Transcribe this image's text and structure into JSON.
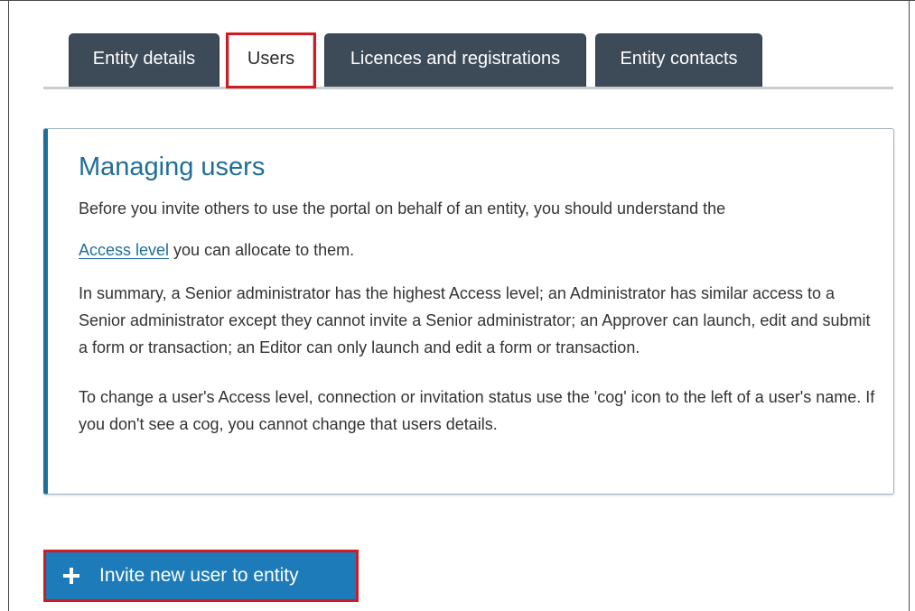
{
  "tabs": [
    {
      "label": "Entity details",
      "active": false
    },
    {
      "label": "Users",
      "active": true
    },
    {
      "label": "Licences and registrations",
      "active": false
    },
    {
      "label": "Entity contacts",
      "active": false
    }
  ],
  "info": {
    "title": "Managing users",
    "p1": "Before you invite others to use the portal on behalf of an entity, you should understand the",
    "p2_link": "Access level",
    "p2_rest": " you can allocate to them.",
    "p3": "In summary, a Senior administrator has the highest Access level; an Administrator has similar access to a Senior administrator except they cannot invite a Senior administrator; an Approver can launch, edit and submit a form or transaction; an Editor can only launch and edit a form or transaction.",
    "p4": "To change a user's Access level, connection or invitation status use the 'cog' icon to the left of a user's name. If you don't see a cog, you cannot change that users details."
  },
  "invite_button": {
    "label": "Invite new user to entity",
    "icon": "plus-icon"
  },
  "colors": {
    "tab_dark": "#3d4a58",
    "accent_blue": "#1f6e99",
    "button_blue": "#1c7bb8",
    "highlight_red": "#d11b24"
  }
}
